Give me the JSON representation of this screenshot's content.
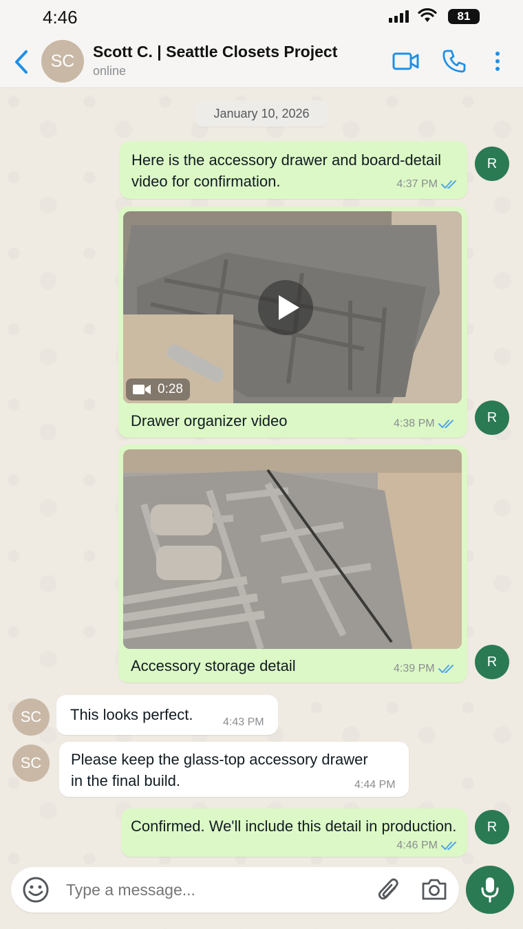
{
  "status_bar": {
    "time": "4:46",
    "battery": "81"
  },
  "header": {
    "avatar_initials": "SC",
    "contact_name": "Scott C. | Seattle  Closets Project",
    "contact_status": "online"
  },
  "chat": {
    "date_chip": "January 10, 2026",
    "messages": [
      {
        "from": "R",
        "text_lines": [
          "Here is the accessory drawer and board-detail",
          "video for confirmation."
        ],
        "time": "4:37 PM",
        "read": true
      },
      {
        "from": "R",
        "media": "video",
        "duration": "0:28",
        "caption": "Drawer organizer video",
        "time": "4:38 PM",
        "read": true
      },
      {
        "from": "R",
        "media": "image",
        "caption": "Accessory storage detail",
        "time": "4:39 PM",
        "read": true
      },
      {
        "from": "SC",
        "text_lines": [
          "This looks perfect."
        ],
        "time": "4:43 PM"
      },
      {
        "from": "SC",
        "text_lines": [
          "Please keep the glass-top accessory drawer",
          "in the final build."
        ],
        "time": "4:44 PM"
      },
      {
        "from": "R",
        "text_lines": [
          "Confirmed. We'll include this detail in production."
        ],
        "time": "4:46 PM",
        "read": true
      }
    ]
  },
  "composer": {
    "placeholder": "Type a message..."
  },
  "colors": {
    "accent": "#1f8fe5",
    "outgoing_bubble": "#dcf8c6",
    "read_ticks": "#4fa6e8",
    "avatar_green": "#2a7a54",
    "mic_button": "#2a7a54"
  }
}
